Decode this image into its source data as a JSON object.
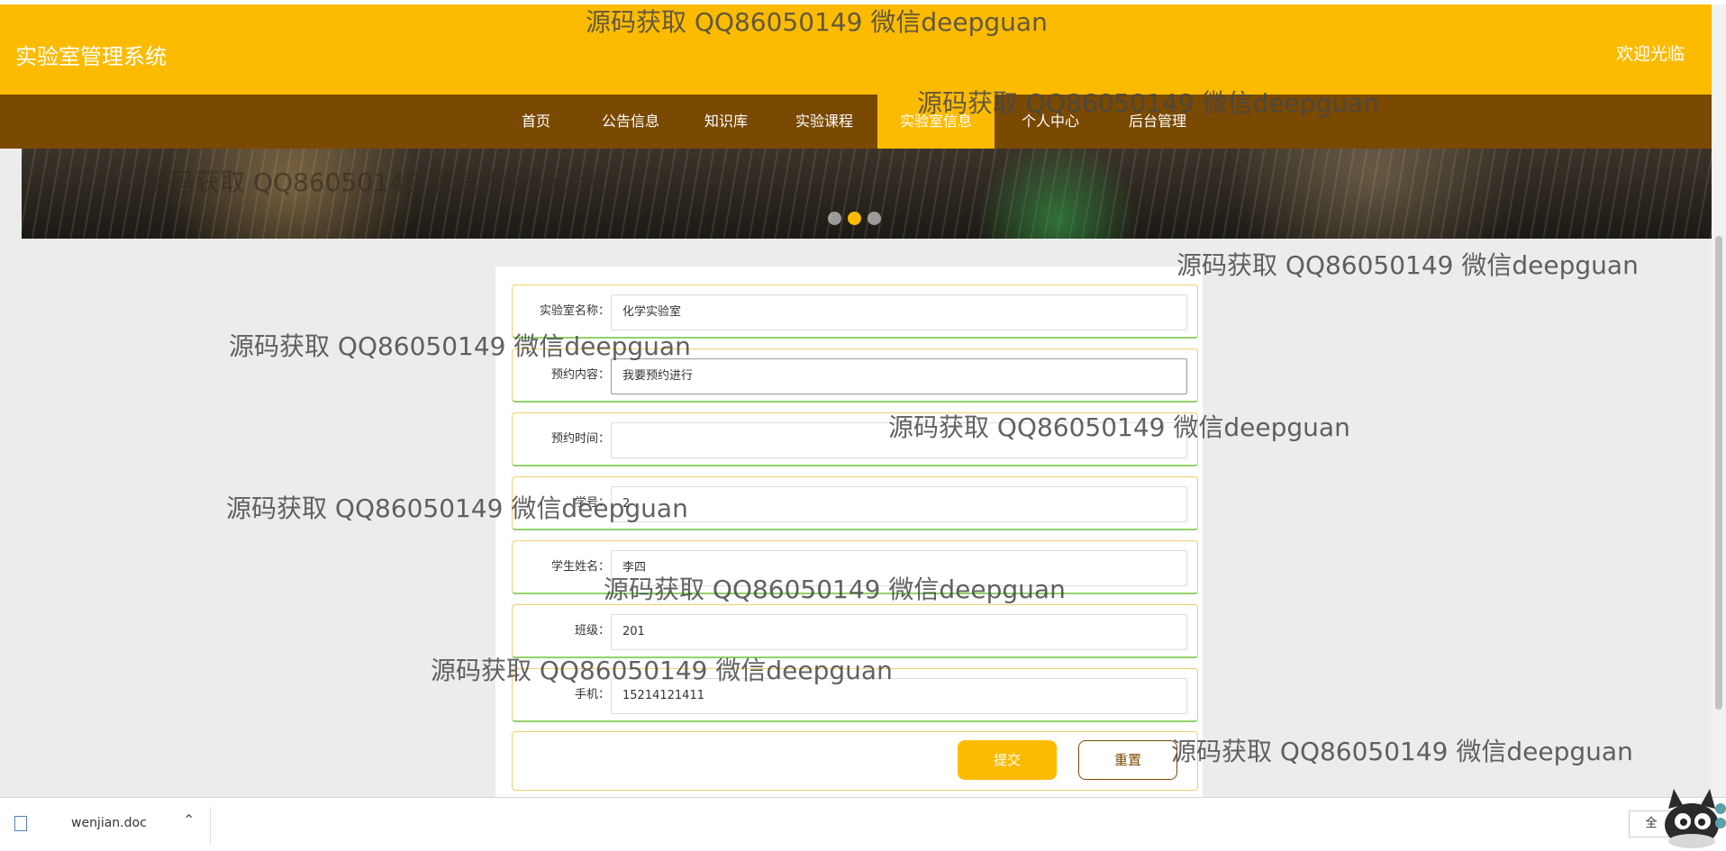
{
  "header": {
    "title": "实验室管理系统",
    "welcome": "欢迎光临"
  },
  "nav": {
    "items": [
      {
        "label": "首页"
      },
      {
        "label": "公告信息"
      },
      {
        "label": "知识库"
      },
      {
        "label": "实验课程"
      },
      {
        "label": "实验室信息"
      },
      {
        "label": "个人中心"
      },
      {
        "label": "后台管理"
      }
    ],
    "active_index": 4
  },
  "banner": {
    "slide_count": 3,
    "active_slide": 2
  },
  "form": {
    "fields": [
      {
        "label": "实验室名称：",
        "value": "化学实验室"
      },
      {
        "label": "预约内容：",
        "value": "我要预约进行"
      },
      {
        "label": "预约时间：",
        "value": ""
      },
      {
        "label": "学号：",
        "value": "2"
      },
      {
        "label": "学生姓名：",
        "value": "李四"
      },
      {
        "label": "班级：",
        "value": "201"
      },
      {
        "label": "手机：",
        "value": "15214121411"
      }
    ],
    "submit_label": "提交",
    "reset_label": "重置"
  },
  "watermark_text": "源码获取 QQ86050149 微信deepguan",
  "download_bar": {
    "file_name": "wenjian.doc",
    "show_all_label": "全"
  },
  "colors": {
    "accent": "#fdbb00",
    "nav_bg": "#7a4902",
    "page_bg": "#ececec"
  }
}
